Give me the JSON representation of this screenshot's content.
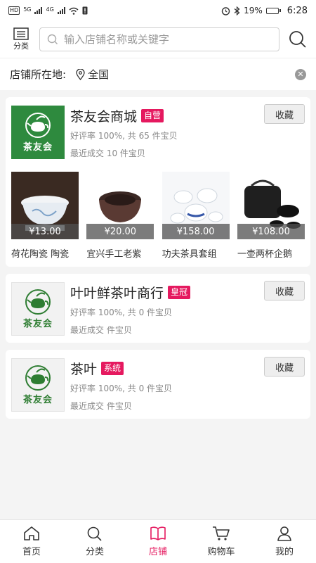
{
  "status": {
    "left_chip": "HD",
    "net1": "5G",
    "net2": "4G",
    "battery_percent": "19%",
    "battery_level": 0.19,
    "time": "6:28"
  },
  "topbar": {
    "category_label": "分类",
    "search_placeholder": "输入店铺名称或关键字"
  },
  "location": {
    "label": "店铺所在地:",
    "value": "全国"
  },
  "shops": [
    {
      "name": "茶友会商城",
      "badge": "自营",
      "meta1": "好评率 100%, 共 65 件宝贝",
      "meta2": "最近成交 10 件宝贝",
      "fav_label": "收藏",
      "logo_text": "茶友会",
      "products": [
        {
          "price": "¥13.00",
          "name": "荷花陶瓷 陶瓷"
        },
        {
          "price": "¥20.00",
          "name": "宜兴手工老紫"
        },
        {
          "price": "¥158.00",
          "name": "功夫茶具套组"
        },
        {
          "price": "¥108.00",
          "name": "一壶两杯企鹅"
        }
      ]
    },
    {
      "name": "叶叶鲜茶叶商行",
      "badge": "皇冠",
      "meta1": "好评率 100%, 共 0 件宝贝",
      "meta2": "最近成交 件宝贝",
      "fav_label": "收藏",
      "logo_text": "茶友会"
    },
    {
      "name": "茶叶",
      "badge": "系统",
      "meta1": "好评率 100%, 共 0 件宝贝",
      "meta2": "最近成交 件宝贝",
      "fav_label": "收藏",
      "logo_text": "茶友会"
    }
  ],
  "tabs": [
    {
      "label": "首页",
      "icon": "home-icon"
    },
    {
      "label": "分类",
      "icon": "search-icon"
    },
    {
      "label": "店铺",
      "icon": "book-icon"
    },
    {
      "label": "购物车",
      "icon": "cart-icon"
    },
    {
      "label": "我的",
      "icon": "user-icon"
    }
  ],
  "colors": {
    "accent": "#e5195f",
    "logo_green": "#2e8a3e"
  }
}
